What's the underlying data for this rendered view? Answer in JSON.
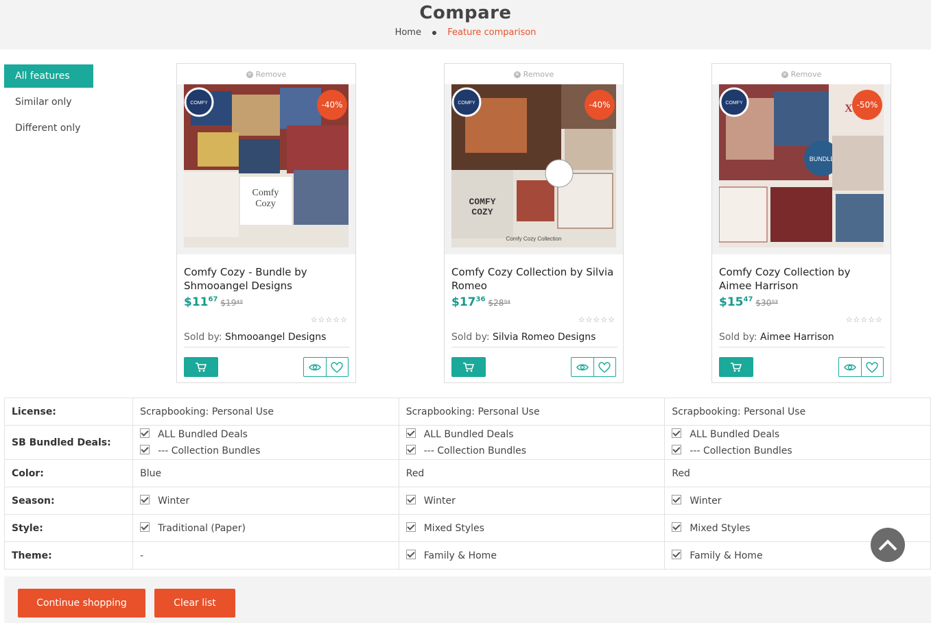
{
  "header": {
    "title": "Compare",
    "breadcrumb": [
      "Home",
      "Feature comparison"
    ]
  },
  "filters": [
    "All features",
    "Similar only",
    "Different only"
  ],
  "remove_label": "Remove",
  "products": [
    {
      "discount": "-40%",
      "title": "Comfy Cozy - Bundle by Shmooangel Designs",
      "price_main": "$11",
      "price_cents": "67",
      "old_price": "$19⁴⁹",
      "sold_by_label": "Sold by:",
      "seller": "Shmooangel Designs",
      "rating_stars": "☆☆☆☆☆"
    },
    {
      "discount": "-40%",
      "title": "Comfy Cozy Collection by Silvia Romeo",
      "price_main": "$17",
      "price_cents": "36",
      "old_price": "$28⁹⁴",
      "sold_by_label": "Sold by:",
      "seller": "Silvia Romeo Designs",
      "rating_stars": "☆☆☆☆☆"
    },
    {
      "discount": "-50%",
      "title": "Comfy Cozy Collection by Aimee Harrison",
      "price_main": "$15",
      "price_cents": "47",
      "old_price": "$30⁹³",
      "sold_by_label": "Sold by:",
      "seller": "Aimee Harrison",
      "rating_stars": "☆☆☆☆☆"
    }
  ],
  "features": {
    "license": {
      "label": "License:",
      "values": [
        "Scrapbooking: Personal Use",
        "Scrapbooking: Personal Use",
        "Scrapbooking: Personal Use"
      ]
    },
    "bundled": {
      "label": "SB Bundled Deals:",
      "line1": "ALL Bundled Deals",
      "line2": "--- Collection Bundles"
    },
    "color": {
      "label": "Color:",
      "values": [
        "Blue",
        "Red",
        "Red"
      ]
    },
    "season": {
      "label": "Season:",
      "values": [
        "Winter",
        "Winter",
        "Winter"
      ]
    },
    "style": {
      "label": "Style:",
      "values": [
        "Traditional (Paper)",
        "Mixed Styles",
        "Mixed Styles"
      ]
    },
    "theme": {
      "label": "Theme:",
      "values": [
        "-",
        "Family & Home",
        "Family & Home"
      ]
    }
  },
  "footer": {
    "continue": "Continue shopping",
    "clear": "Clear list"
  },
  "colors": {
    "accent": "#1aa99a",
    "brand": "#e8512a"
  }
}
